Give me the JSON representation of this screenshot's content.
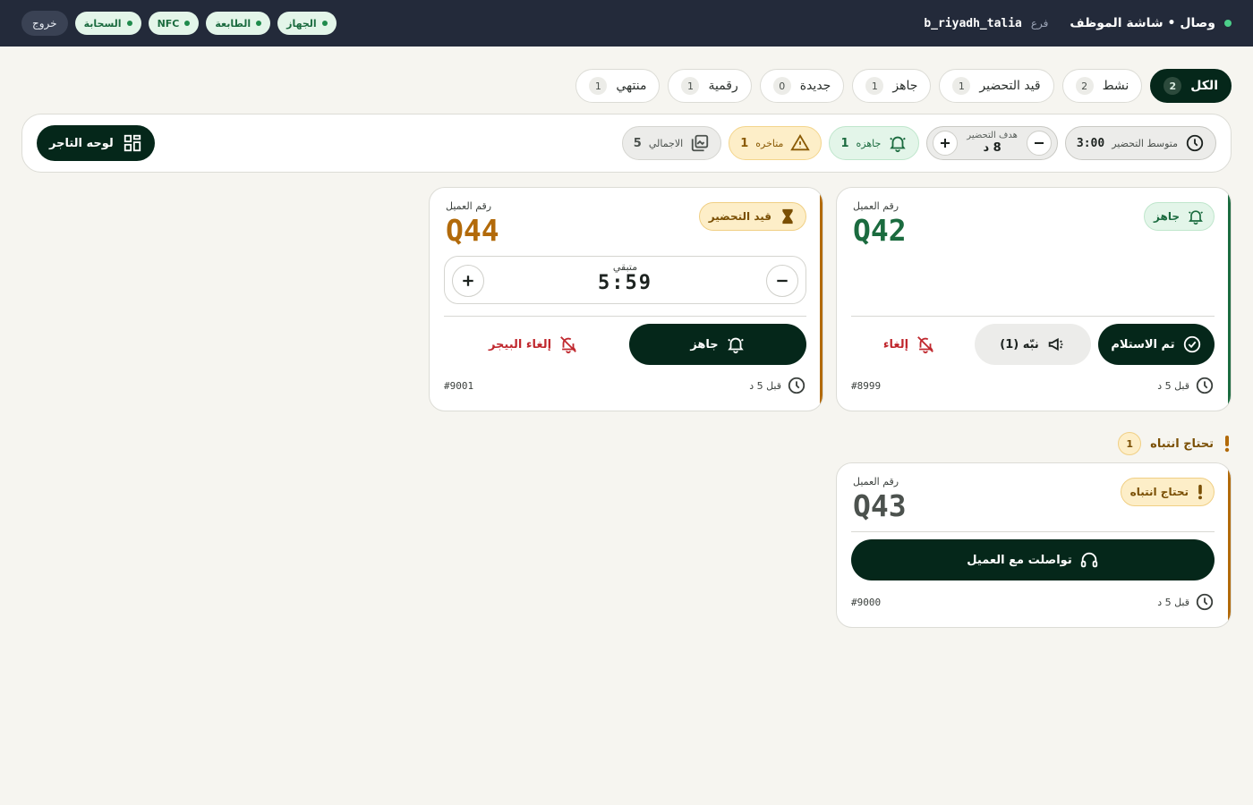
{
  "header": {
    "title": "وصال • شاشة الموظف",
    "branch_label": "فرع",
    "branch_value": "b_riyadh_talia",
    "logout_label": "خروج",
    "status_pills": [
      {
        "label": "الجهاز"
      },
      {
        "label": "الطابعة"
      },
      {
        "label": "NFC"
      },
      {
        "label": "السحابة"
      }
    ]
  },
  "tabs": [
    {
      "label": "الكل",
      "count": "2",
      "active": true
    },
    {
      "label": "نشط",
      "count": "2"
    },
    {
      "label": "قيد التحضير",
      "count": "1"
    },
    {
      "label": "جاهز",
      "count": "1"
    },
    {
      "label": "جديدة",
      "count": "0"
    },
    {
      "label": "رقمية",
      "count": "1"
    },
    {
      "label": "منتهي",
      "count": "1"
    }
  ],
  "stats": {
    "avg_label": "متوسط التحضير",
    "avg_value": "3:00",
    "target_label": "هدف التحضير",
    "target_value": "8 د",
    "ready_label": "جاهزه",
    "ready_value": "1",
    "late_label": "متاخره",
    "late_value": "1",
    "total_label": "الاجمالي",
    "total_value": "5",
    "merchant_label": "لوحه التاجر"
  },
  "cards": {
    "q42": {
      "customer_label": "رقم العميل",
      "number": "Q42",
      "status": "جاهز",
      "received_label": "تم الاستلام",
      "notify_label": "نبّه (1)",
      "cancel_label": "إلغاء",
      "time": "قبل 5 د",
      "order_id": "#8999",
      "accent": "#1b6b3f"
    },
    "q44": {
      "customer_label": "رقم العميل",
      "number": "Q44",
      "status": "قيد التحضير",
      "remaining_label": "متبقي",
      "remaining_value": "5:59",
      "ready_label": "جاهز",
      "cancel_pager_label": "إلغاء البيجر",
      "time": "قبل 5 د",
      "order_id": "#9001",
      "accent": "#b26a0a"
    },
    "q43": {
      "customer_label": "رقم العميل",
      "number": "Q43",
      "status": "تحتاج انتباه",
      "contacted_label": "تواصلت مع العميل",
      "time": "قبل 5 د",
      "order_id": "#9000",
      "accent": "#b26a0a"
    }
  },
  "attention_section": {
    "title": "تحتاج انتباه",
    "count": "1"
  },
  "colors": {
    "primary_dark": "#05271a",
    "ready_green": "#1b6b3f",
    "prep_orange": "#b26a0a",
    "danger_red": "#c0282e",
    "topbar": "#232a3a"
  }
}
